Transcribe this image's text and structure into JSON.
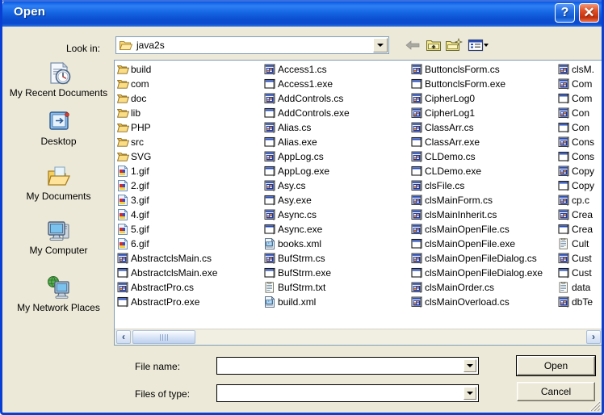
{
  "window": {
    "title": "Open",
    "help_button": "?",
    "close_button": "✕",
    "titlebar_color": "#0a52d6",
    "face_color": "#ece9d8"
  },
  "lookin": {
    "label": "Look in:",
    "value": "java2s",
    "icon": "folder-open-icon"
  },
  "toolbar": {
    "items": [
      {
        "name": "back-button",
        "icon": "back-arrow-icon"
      },
      {
        "name": "up-one-level-button",
        "icon": "up-folder-icon"
      },
      {
        "name": "create-new-folder-button",
        "icon": "new-folder-icon"
      },
      {
        "name": "views-button",
        "icon": "views-list-icon"
      }
    ]
  },
  "places": [
    {
      "label": "My Recent Documents",
      "icon": "recent-documents-icon"
    },
    {
      "label": "Desktop",
      "icon": "desktop-icon"
    },
    {
      "label": "My Documents",
      "icon": "my-documents-icon"
    },
    {
      "label": "My Computer",
      "icon": "my-computer-icon"
    },
    {
      "label": "My Network Places",
      "icon": "network-places-icon"
    }
  ],
  "filelist": {
    "columns": [
      {
        "items": [
          {
            "name": "build",
            "icon": "folder-icon"
          },
          {
            "name": "com",
            "icon": "folder-icon"
          },
          {
            "name": "doc",
            "icon": "folder-icon"
          },
          {
            "name": "lib",
            "icon": "folder-icon"
          },
          {
            "name": "PHP",
            "icon": "folder-icon"
          },
          {
            "name": "src",
            "icon": "folder-icon"
          },
          {
            "name": "SVG",
            "icon": "folder-icon"
          },
          {
            "name": "1.gif",
            "icon": "image-file-icon"
          },
          {
            "name": "2.gif",
            "icon": "image-file-icon"
          },
          {
            "name": "3.gif",
            "icon": "image-file-icon"
          },
          {
            "name": "4.gif",
            "icon": "image-file-icon"
          },
          {
            "name": "5.gif",
            "icon": "image-file-icon"
          },
          {
            "name": "6.gif",
            "icon": "image-file-icon"
          },
          {
            "name": "AbstractclsMain.cs",
            "icon": "csharp-file-icon"
          },
          {
            "name": "AbstractclsMain.exe",
            "icon": "executable-file-icon"
          },
          {
            "name": "AbstractPro.cs",
            "icon": "csharp-file-icon"
          },
          {
            "name": "AbstractPro.exe",
            "icon": "executable-file-icon"
          }
        ]
      },
      {
        "items": [
          {
            "name": "Access1.cs",
            "icon": "csharp-file-icon"
          },
          {
            "name": "Access1.exe",
            "icon": "executable-file-icon"
          },
          {
            "name": "AddControls.cs",
            "icon": "csharp-file-icon"
          },
          {
            "name": "AddControls.exe",
            "icon": "executable-file-icon"
          },
          {
            "name": "Alias.cs",
            "icon": "csharp-file-icon"
          },
          {
            "name": "Alias.exe",
            "icon": "executable-file-icon"
          },
          {
            "name": "AppLog.cs",
            "icon": "csharp-file-icon"
          },
          {
            "name": "AppLog.exe",
            "icon": "executable-file-icon"
          },
          {
            "name": "Asy.cs",
            "icon": "csharp-file-icon"
          },
          {
            "name": "Asy.exe",
            "icon": "executable-file-icon"
          },
          {
            "name": "Async.cs",
            "icon": "csharp-file-icon"
          },
          {
            "name": "Async.exe",
            "icon": "executable-file-icon"
          },
          {
            "name": "books.xml",
            "icon": "xml-file-icon"
          },
          {
            "name": "BufStrm.cs",
            "icon": "csharp-file-icon"
          },
          {
            "name": "BufStrm.exe",
            "icon": "executable-file-icon"
          },
          {
            "name": "BufStrm.txt",
            "icon": "text-file-icon"
          },
          {
            "name": "build.xml",
            "icon": "xml-file-icon"
          }
        ]
      },
      {
        "items": [
          {
            "name": "ButtonclsForm.cs",
            "icon": "csharp-file-icon"
          },
          {
            "name": "ButtonclsForm.exe",
            "icon": "executable-file-icon"
          },
          {
            "name": "CipherLog0",
            "icon": "csharp-file-icon"
          },
          {
            "name": "CipherLog1",
            "icon": "csharp-file-icon"
          },
          {
            "name": "ClassArr.cs",
            "icon": "csharp-file-icon"
          },
          {
            "name": "ClassArr.exe",
            "icon": "executable-file-icon"
          },
          {
            "name": "CLDemo.cs",
            "icon": "csharp-file-icon"
          },
          {
            "name": "CLDemo.exe",
            "icon": "executable-file-icon"
          },
          {
            "name": "clsFile.cs",
            "icon": "csharp-file-icon"
          },
          {
            "name": "clsMainForm.cs",
            "icon": "csharp-file-icon"
          },
          {
            "name": "clsMainInherit.cs",
            "icon": "csharp-file-icon"
          },
          {
            "name": "clsMainOpenFile.cs",
            "icon": "csharp-file-icon"
          },
          {
            "name": "clsMainOpenFile.exe",
            "icon": "executable-file-icon"
          },
          {
            "name": "clsMainOpenFileDialog.cs",
            "icon": "csharp-file-icon"
          },
          {
            "name": "clsMainOpenFileDialog.exe",
            "icon": "executable-file-icon"
          },
          {
            "name": "clsMainOrder.cs",
            "icon": "csharp-file-icon"
          },
          {
            "name": "clsMainOverload.cs",
            "icon": "csharp-file-icon"
          }
        ]
      },
      {
        "items": [
          {
            "name": "clsM.",
            "icon": "csharp-file-icon"
          },
          {
            "name": "Com",
            "icon": "csharp-file-icon"
          },
          {
            "name": "Com",
            "icon": "executable-file-icon"
          },
          {
            "name": "Con",
            "icon": "csharp-file-icon"
          },
          {
            "name": "Con",
            "icon": "executable-file-icon"
          },
          {
            "name": "Cons",
            "icon": "csharp-file-icon"
          },
          {
            "name": "Cons",
            "icon": "executable-file-icon"
          },
          {
            "name": "Copy",
            "icon": "csharp-file-icon"
          },
          {
            "name": "Copy",
            "icon": "executable-file-icon"
          },
          {
            "name": "cp.c",
            "icon": "csharp-file-icon"
          },
          {
            "name": "Crea",
            "icon": "csharp-file-icon"
          },
          {
            "name": "Crea",
            "icon": "executable-file-icon"
          },
          {
            "name": "Cult",
            "icon": "text-file-icon"
          },
          {
            "name": "Cust",
            "icon": "csharp-file-icon"
          },
          {
            "name": "Cust",
            "icon": "executable-file-icon"
          },
          {
            "name": "data",
            "icon": "text-file-icon"
          },
          {
            "name": "dbTe",
            "icon": "csharp-file-icon"
          }
        ]
      }
    ]
  },
  "hscroll": {
    "left_button": "‹",
    "right_button": "›"
  },
  "fields": {
    "filename_label": "File name:",
    "filename_value": "",
    "filename_placeholder": "",
    "filetype_label": "Files of type:",
    "filetype_value": "",
    "filetype_placeholder": ""
  },
  "buttons": {
    "open": "Open",
    "cancel": "Cancel"
  }
}
